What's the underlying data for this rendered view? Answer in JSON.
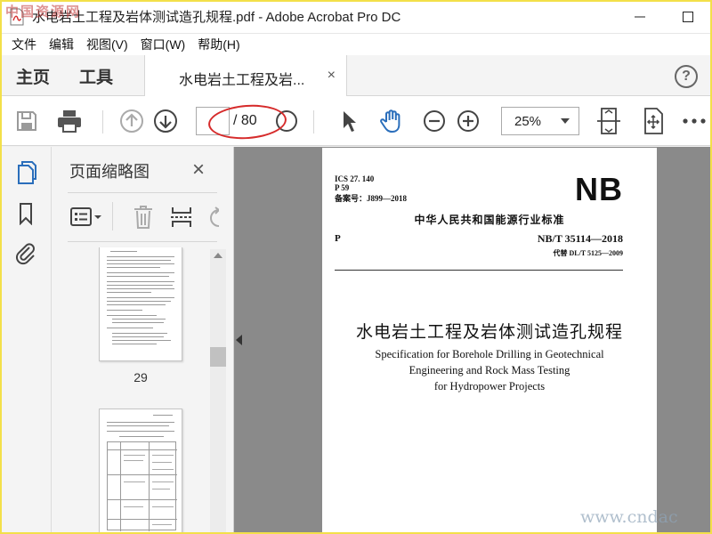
{
  "window": {
    "title": "水电岩土工程及岩体测试造孔规程.pdf - Adobe Acrobat Pro DC",
    "minimize_label": "—",
    "maximize_label": "☐"
  },
  "menu": [
    "文件",
    "编辑",
    "视图(V)",
    "窗口(W)",
    "帮助(H)"
  ],
  "tabs": {
    "home": "主页",
    "tools": "工具",
    "document": "水电岩土工程及岩...",
    "close_symbol": "×",
    "help_symbol": "?"
  },
  "toolbar": {
    "page_current": "",
    "page_total": "/ 80",
    "zoom": "25%"
  },
  "sidebar": {
    "title": "页面缩略图",
    "close_symbol": "×",
    "thumbnails": [
      {
        "page_label": "29"
      }
    ]
  },
  "document": {
    "ics": "ICS 27. 140",
    "p_class": "P 59",
    "record_no": "备案号：J899—2018",
    "mark": "NB",
    "org": "中华人民共和国能源行业标准",
    "p_code": "P",
    "std_no": "NB/T 35114—2018",
    "replaces": "代替 DL/T 5125—2009",
    "title_zh": "水电岩土工程及岩体测试造孔规程",
    "title_en": [
      "Specification for Borehole Drilling in Geotechnical",
      "Engineering and Rock Mass Testing",
      "for Hydropower Projects"
    ]
  },
  "watermarks": {
    "top_left": "中国资源网",
    "bottom_right": "www.cndac"
  },
  "colors": {
    "accent_blue": "#2a6ebb",
    "annotation_red": "#d62b2b",
    "frame_yellow": "#f3e04a"
  }
}
